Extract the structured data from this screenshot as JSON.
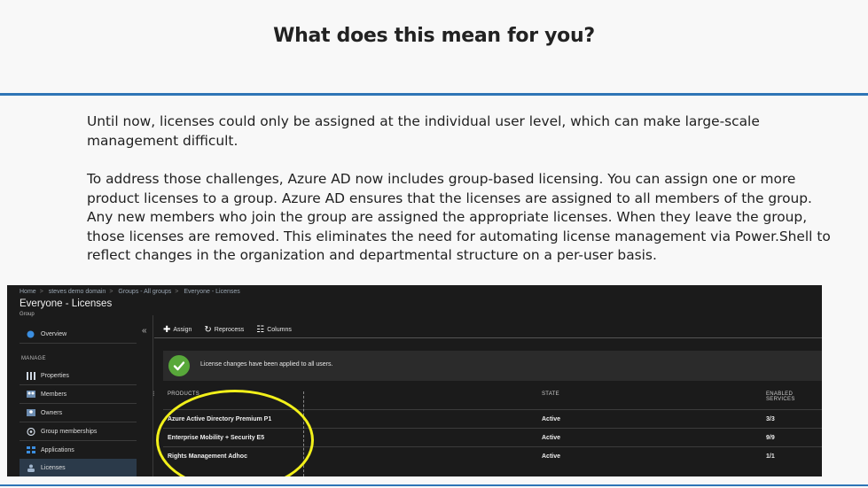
{
  "slide": {
    "title": "What does this mean for you?",
    "paragraph_1": "Until now, licenses could only be assigned at the individual user level, which can make large-scale management difficult.",
    "paragraph_2": "To address those challenges, Azure AD now includes group-based licensing. You can assign one or more product licenses to a group. Azure AD ensures that the licenses are assigned to all members of the group. Any new members who join the group are assigned the appropriate licenses. When they leave the group, those licenses are removed. This eliminates the need for automating license management via Power.Shell to reflect changes in the organization and departmental structure on a per-user basis.",
    "accent_color": "#2e75b6"
  },
  "portal": {
    "breadcrumb": [
      "Home",
      "steves demo domain",
      "Groups - All groups",
      "Everyone - Licenses"
    ],
    "blade_title": "Everyone - Licenses",
    "blade_subtitle": "Group",
    "collapse_glyph": "«",
    "sidebar": {
      "overview": "Overview",
      "section_label": "MANAGE",
      "items": [
        {
          "label": "Properties",
          "icon": "properties-icon"
        },
        {
          "label": "Members",
          "icon": "members-icon"
        },
        {
          "label": "Owners",
          "icon": "owners-icon"
        },
        {
          "label": "Group memberships",
          "icon": "group-memberships-icon"
        },
        {
          "label": "Applications",
          "icon": "applications-icon"
        },
        {
          "label": "Licenses",
          "icon": "licenses-icon"
        }
      ]
    },
    "toolbar": {
      "assign": "Assign",
      "reprocess": "Reprocess",
      "columns": "Columns"
    },
    "notice": {
      "message": "License changes have been applied to all users.",
      "status_color": "#58a83a"
    },
    "table": {
      "headers": [
        "PRODUCTS",
        "STATE",
        "ENABLED SERVICES"
      ],
      "rows": [
        [
          "Azure Active Directory Premium P1",
          "Active",
          "3/3"
        ],
        [
          "Enterprise Mobility + Security E5",
          "Active",
          "9/9"
        ],
        [
          "Rights Management Adhoc",
          "Active",
          "1/1"
        ]
      ]
    },
    "highlight_color": "#f2f01a"
  }
}
